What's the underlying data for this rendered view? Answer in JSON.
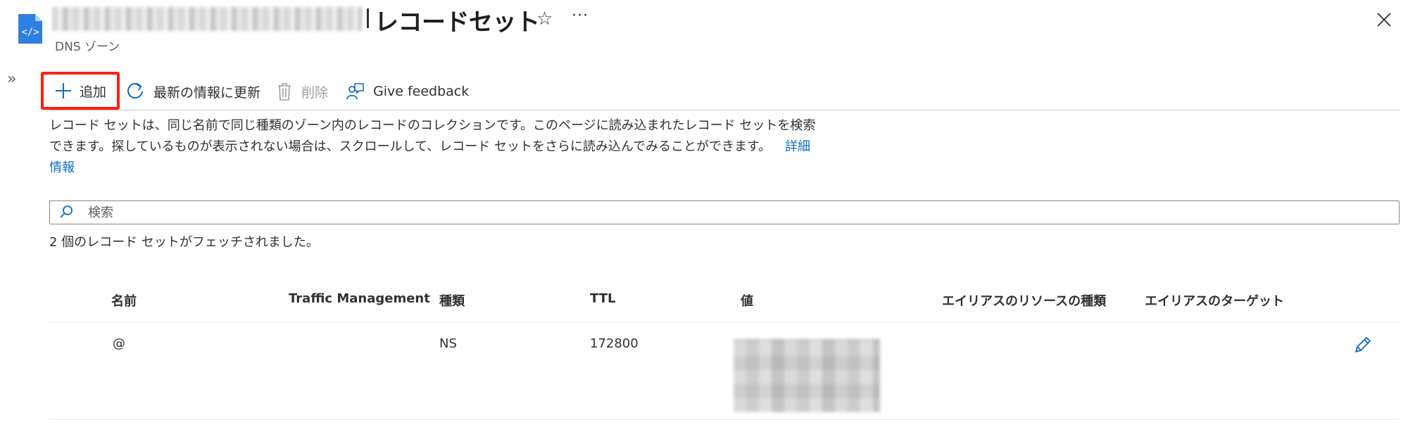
{
  "header": {
    "title": "レコードセット",
    "subtitle": "DNS ゾーン",
    "favorite_glyph": "☆",
    "more_glyph": "···",
    "expand_glyph": "»",
    "icons": {
      "file": "dns-zone-file-icon",
      "close": "close-icon",
      "favorite": "star-icon",
      "more": "more-icon"
    }
  },
  "toolbar": {
    "add_label": "追加",
    "refresh_label": "最新の情報に更新",
    "delete_label": "削除",
    "feedback_label": "Give feedback"
  },
  "description": {
    "text": "レコード セットは、同じ名前で同じ種類のゾーン内のレコードのコレクションです。このページに読み込まれたレコード セットを検索できます。探しているものが表示されない場合は、スクロールして、レコード セットをさらに読み込んでみることができます。",
    "link_label": "詳細情報"
  },
  "search": {
    "placeholder": "検索",
    "value": ""
  },
  "status": {
    "fetched": "2 個のレコード セットがフェッチされました。"
  },
  "table": {
    "columns": [
      "名前",
      "Traffic Management",
      "種類",
      "TTL",
      "値",
      "エイリアスのリソースの種類",
      "エイリアスのターゲット"
    ],
    "rows": [
      {
        "name": "@",
        "traffic_management": "",
        "type": "NS",
        "ttl": "172800",
        "alias_resource_type": "",
        "alias_target": ""
      }
    ]
  },
  "colors": {
    "accent": "#0f6cbd",
    "highlight_box": "#ff1f0f",
    "text": "#323130",
    "disabled": "#a19f9d"
  }
}
